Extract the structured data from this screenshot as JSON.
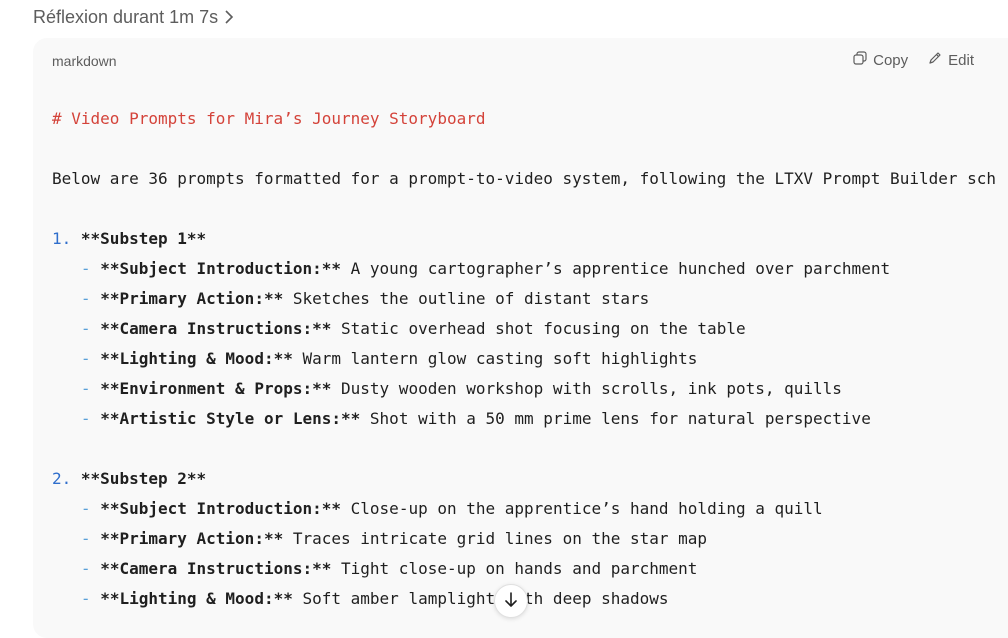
{
  "header": {
    "thinking_label": "Réflexion durant 1m 7s"
  },
  "code_block": {
    "language": "markdown",
    "copy_label": "Copy",
    "edit_label": "Edit",
    "heading": "# Video Prompts for Mira’s Journey Storyboard",
    "intro": "Below are 36 prompts formatted for a prompt-to-video system, following the LTXV Prompt Builder sch",
    "substeps": [
      {
        "number": "1.",
        "title": "**Substep 1**",
        "items": [
          {
            "key": "**Subject Introduction:**",
            "text": " A young cartographer’s apprentice hunched over parchment"
          },
          {
            "key": "**Primary Action:**",
            "text": " Sketches the outline of distant stars"
          },
          {
            "key": "**Camera Instructions:**",
            "text": " Static overhead shot focusing on the table"
          },
          {
            "key": "**Lighting & Mood:**",
            "text": " Warm lantern glow casting soft highlights"
          },
          {
            "key": "**Environment & Props:**",
            "text": " Dusty wooden workshop with scrolls, ink pots, quills"
          },
          {
            "key": "**Artistic Style or Lens:**",
            "text": " Shot with a 50 mm prime lens for natural perspective"
          }
        ]
      },
      {
        "number": "2.",
        "title": "**Substep 2**",
        "items": [
          {
            "key": "**Subject Introduction:**",
            "text": " Close-up on the apprentice’s hand holding a quill"
          },
          {
            "key": "**Primary Action:**",
            "text": " Traces intricate grid lines on the star map"
          },
          {
            "key": "**Camera Instructions:**",
            "text": " Tight close-up on hands and parchment"
          },
          {
            "key": "**Lighting & Mood:**",
            "text": " Soft amber lamplight with deep shadows"
          }
        ]
      }
    ]
  },
  "icons": {
    "chevron": "chevron-right-icon",
    "copy": "copy-icon",
    "edit": "edit-icon",
    "scroll": "arrow-down-icon"
  }
}
